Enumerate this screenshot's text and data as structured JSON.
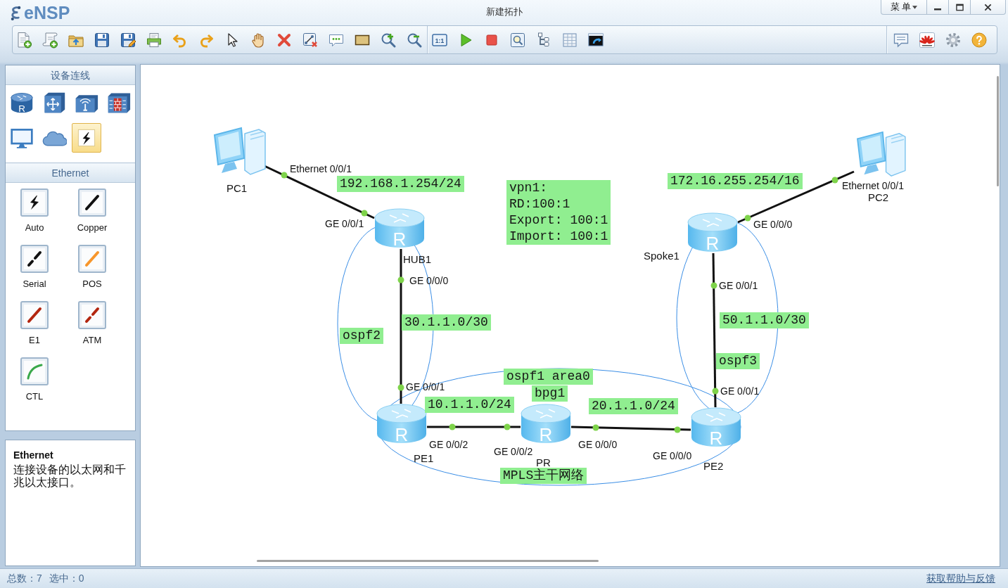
{
  "window": {
    "logo": "eNSP",
    "title": "新建拓扑",
    "menu": "菜 单"
  },
  "toolbar": {
    "actual_size": "1:1"
  },
  "sidebar": {
    "devices_header": "设备连线",
    "devices": [
      {
        "kind": "router",
        "icon_letter": "R",
        "selected": false
      },
      {
        "kind": "switch",
        "selected": false
      },
      {
        "kind": "wireless",
        "selected": false
      },
      {
        "kind": "firewall",
        "selected": false
      },
      {
        "kind": "pc",
        "selected": false
      },
      {
        "kind": "cloud",
        "selected": false
      },
      {
        "kind": "connection",
        "selected": true
      }
    ],
    "cables_header": "Ethernet",
    "cables": [
      {
        "kind": "auto",
        "label": "Auto"
      },
      {
        "kind": "copper",
        "label": "Copper"
      },
      {
        "kind": "serial",
        "label": "Serial"
      },
      {
        "kind": "pos",
        "label": "POS"
      },
      {
        "kind": "e1",
        "label": "E1"
      },
      {
        "kind": "atm",
        "label": "ATM"
      },
      {
        "kind": "ctl",
        "label": "CTL"
      }
    ]
  },
  "info": {
    "title": "Ethernet",
    "text": "连接设备的以太网和千兆以太接口。"
  },
  "topology": {
    "nodes": [
      {
        "kind": "pc",
        "label": "PC1"
      },
      {
        "kind": "pc",
        "label": "PC2"
      },
      {
        "kind": "router",
        "label": "HUB1",
        "icon_letter": "R"
      },
      {
        "kind": "router",
        "label": "Spoke1",
        "icon_letter": "R"
      },
      {
        "kind": "router",
        "label": "PE1",
        "icon_letter": "R"
      },
      {
        "kind": "router",
        "label": "PR",
        "icon_letter": "R"
      },
      {
        "kind": "router",
        "label": "PE2",
        "icon_letter": "R"
      }
    ],
    "links": [
      {
        "ports": [
          "Ethernet 0/0/1",
          "GE 0/0/1"
        ]
      },
      {
        "ports": [
          "GE 0/0/0",
          "Ethernet 0/0/1"
        ]
      },
      {
        "ports": [
          "GE 0/0/0",
          "GE 0/0/1"
        ]
      },
      {
        "ports": [
          "GE 0/0/1",
          "GE 0/0/1"
        ]
      },
      {
        "ports": [
          "GE 0/0/2",
          "GE 0/0/2"
        ]
      },
      {
        "ports": [
          "GE 0/0/0",
          "GE 0/0/0"
        ]
      }
    ],
    "notes": [
      "192.168.1.254/24",
      "vpn1:\nRD:100:1\nExport: 100:1\nImport: 100:1",
      "172.16.255.254/16",
      "30.1.1.0/30",
      "50.1.1.0/30",
      "ospf2",
      "ospf3",
      "ospf1 area0",
      "bpg1",
      "10.1.1.0/24",
      "20.1.1.0/24",
      "MPLS主干网络"
    ]
  },
  "status_bar": {
    "total_count": "总数：7",
    "selected_count": "选中：0",
    "help_link": "获取帮助与反馈"
  }
}
